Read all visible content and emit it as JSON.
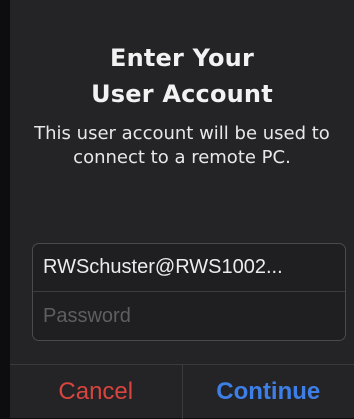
{
  "dialog": {
    "title_line1": "Enter Your",
    "title_line2": "User Account",
    "message": "This user account will be used to connect to a remote PC.",
    "username_value": "RWSchuster@RWS1002...",
    "password_placeholder": "Password",
    "cancel_label": "Cancel",
    "continue_label": "Continue"
  },
  "colors": {
    "background": "#242426",
    "cancel": "#d9443e",
    "continue": "#3d7fe6"
  }
}
